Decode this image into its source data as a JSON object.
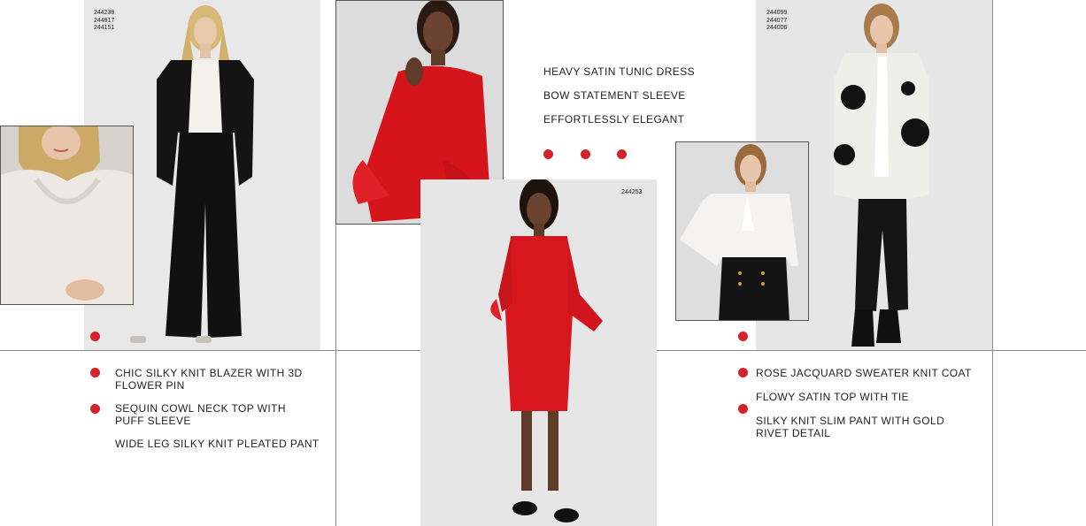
{
  "colors": {
    "accent": "#d6202a",
    "text": "#222222",
    "photo_bg": "#e6e6e6",
    "rule": "#8a8a8a"
  },
  "left_look": {
    "style_codes": [
      "244239",
      "244917",
      "244151"
    ],
    "items": [
      "CHIC SILKY KNIT BLAZER WITH 3D FLOWER PIN",
      "SEQUIN COWL NECK TOP WITH PUFF SLEEVE",
      "WIDE LEG SILKY KNIT PLEATED PANT"
    ]
  },
  "center_look": {
    "style_codes": [
      "244253"
    ],
    "items": [
      "HEAVY SATIN TUNIC DRESS",
      "BOW STATEMENT SLEEVE",
      "EFFORTLESSLY ELEGANT"
    ]
  },
  "right_look": {
    "style_codes": [
      "244099",
      "244077",
      "244006"
    ],
    "items": [
      "ROSE JACQUARD SWEATER KNIT COAT",
      "FLOWY SATIN TOP WITH TIE",
      "SILKY KNIT SLIM PANT WITH GOLD RIVET DETAIL"
    ]
  }
}
